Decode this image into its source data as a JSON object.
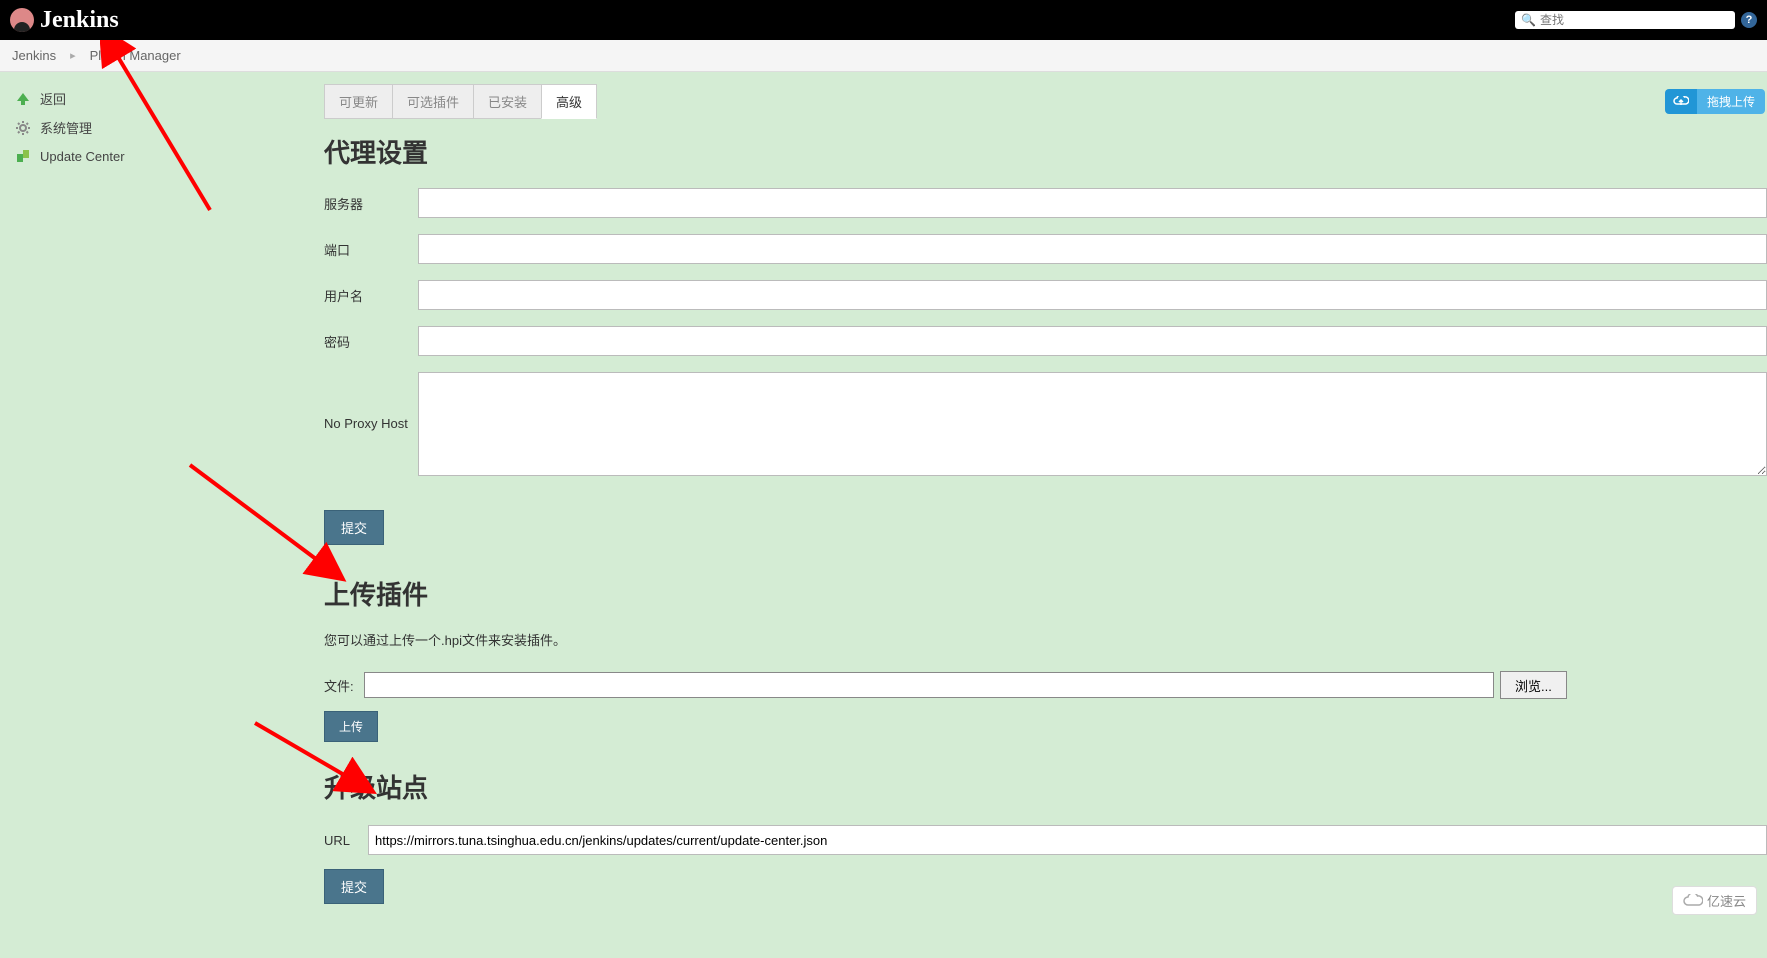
{
  "header": {
    "title": "Jenkins",
    "search_placeholder": "查找"
  },
  "breadcrumb": {
    "items": [
      "Jenkins",
      "Plugin Manager"
    ]
  },
  "sidebar": {
    "items": [
      {
        "label": "返回"
      },
      {
        "label": "系统管理"
      },
      {
        "label": "Update Center"
      }
    ]
  },
  "tabs": {
    "items": [
      "可更新",
      "可选插件",
      "已安装",
      "高级"
    ],
    "active": "高级"
  },
  "upload_toggle": {
    "label": "拖拽上传"
  },
  "sections": {
    "proxy": {
      "title": "代理设置",
      "fields": {
        "server": "服务器",
        "port": "端口",
        "user": "用户名",
        "password": "密码",
        "noproxy": "No Proxy Host"
      },
      "submit": "提交"
    },
    "upload": {
      "title": "上传插件",
      "desc": "您可以通过上传一个.hpi文件来安装插件。",
      "file_label": "文件:",
      "browse": "浏览...",
      "upload_btn": "上传"
    },
    "update_site": {
      "title": "升级站点",
      "url_label": "URL",
      "url_value": "https://mirrors.tuna.tsinghua.edu.cn/jenkins/updates/current/update-center.json",
      "submit": "提交"
    }
  },
  "watermark": "亿速云"
}
